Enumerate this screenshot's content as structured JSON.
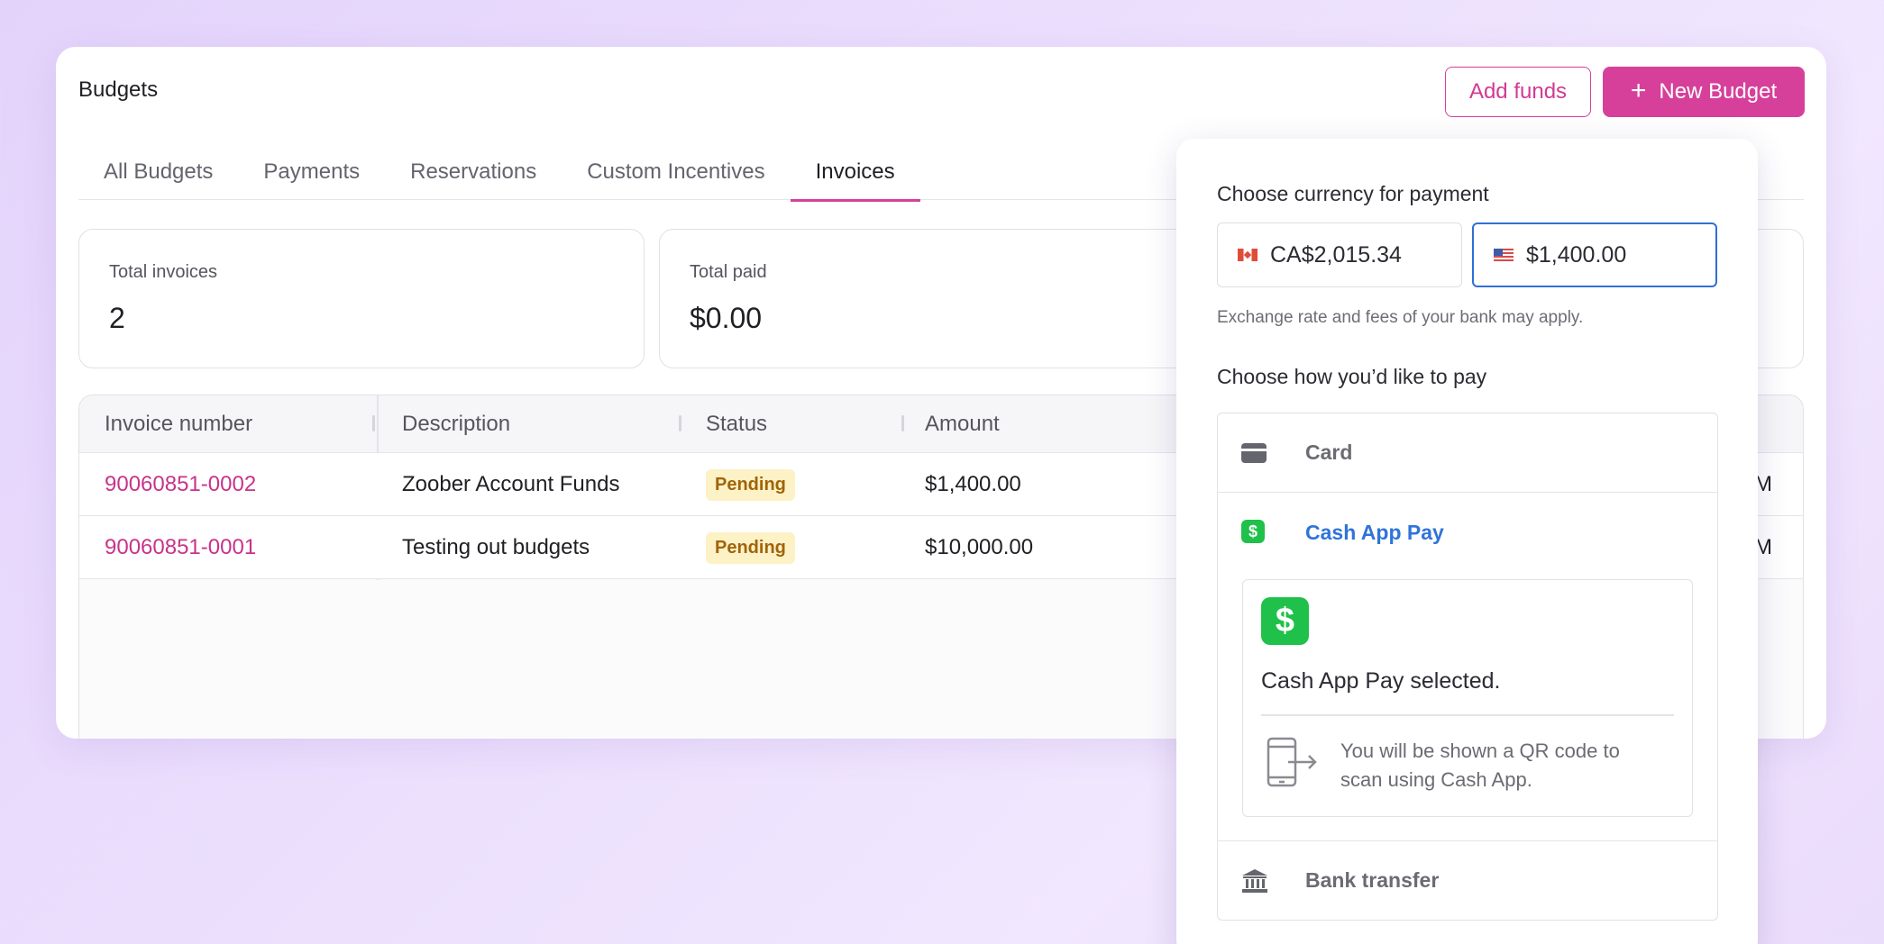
{
  "header": {
    "title": "Budgets",
    "add_funds_label": "Add funds",
    "new_budget_label": "New Budget"
  },
  "tabs": [
    {
      "label": "All Budgets"
    },
    {
      "label": "Payments"
    },
    {
      "label": "Reservations"
    },
    {
      "label": "Custom Incentives"
    },
    {
      "label": "Invoices",
      "active": true
    }
  ],
  "stats": [
    {
      "label": "Total invoices",
      "value": "2"
    },
    {
      "label": "Total paid",
      "value": "$0.00"
    }
  ],
  "table": {
    "columns": [
      "Invoice number",
      "Description",
      "Status",
      "Amount"
    ],
    "rows": [
      {
        "invoice": "90060851-0002",
        "description": "Zoober Account Funds",
        "status": "Pending",
        "amount": "$1,400.00",
        "trailing": "M"
      },
      {
        "invoice": "90060851-0001",
        "description": "Testing out budgets",
        "status": "Pending",
        "amount": "$10,000.00",
        "trailing": "M"
      }
    ]
  },
  "payment": {
    "currency_heading": "Choose currency for payment",
    "currencies": [
      {
        "code": "CA",
        "flag_icon": "canada-flag-icon",
        "value": "CA$2,015.34",
        "selected": false
      },
      {
        "code": "US",
        "flag_icon": "us-flag-icon",
        "value": "$1,400.00",
        "selected": true
      }
    ],
    "note": "Exchange rate and fees of your bank may apply.",
    "method_heading": "Choose how you’d like to pay",
    "methods": [
      {
        "label": "Card",
        "icon": "credit-card-icon"
      },
      {
        "label": "Cash App Pay",
        "icon": "cash-app-icon",
        "selected": true
      },
      {
        "label": "Bank transfer",
        "icon": "bank-icon"
      }
    ],
    "cash_app": {
      "selected_text": "Cash App Pay selected.",
      "description": "You will be shown a QR code to scan using Cash App."
    }
  },
  "colors": {
    "accent": "#d6409a",
    "link": "#c9338a",
    "selected_blue": "#2f6fd6",
    "cash_app_green": "#1fc14a",
    "pending_bg": "#fdf1c6",
    "pending_text": "#a0640a"
  }
}
